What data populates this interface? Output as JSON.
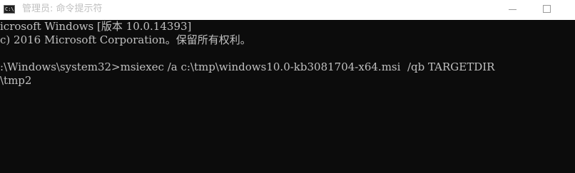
{
  "window": {
    "title": "管理员: 命令提示符",
    "icon": "cmd-icon"
  },
  "console": {
    "lines": [
      "icrosoft Windows [版本 10.0.14393]",
      "c) 2016 Microsoft Corporation。保留所有权利。",
      ":\\Windows\\system32>msiexec /a c:\\tmp\\windows10.0-kb3081704-x64.msi  /qb TARGETDIR",
      "\\tmp2"
    ]
  },
  "colors": {
    "console_background": "#0c0c0c",
    "console_text": "#c0c0c0",
    "titlebar_background": "#ffffff",
    "title_text": "#b5b5b5"
  }
}
